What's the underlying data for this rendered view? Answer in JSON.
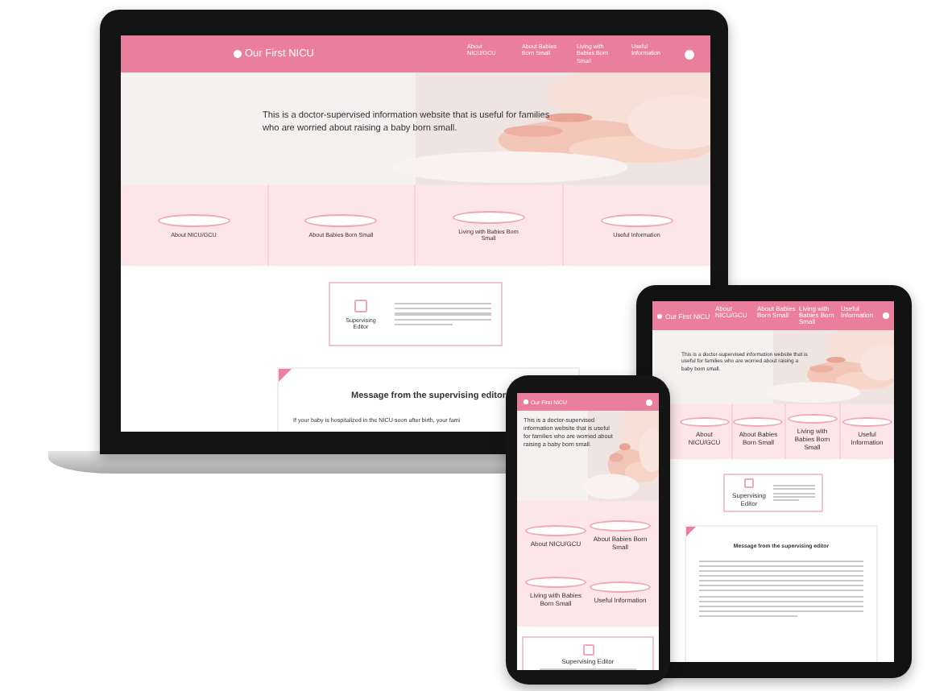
{
  "devices": [
    {
      "kind": "laptop",
      "site": {
        "logo": "Our First NICU",
        "nav": [
          "About NICU/GCU",
          "About Babies Born Small",
          "Living with Babies Born Small",
          "Useful Information"
        ],
        "hero": {
          "text": "This is a doctor-supervised information website that is useful for families who are worried about raising a baby born small."
        },
        "categories": [
          "About NICU/GCU",
          "About Babies Born Small",
          "Living with Babies Born Small",
          "Useful Information"
        ],
        "editor": {
          "label": "Supervising Editor"
        },
        "message": {
          "title": "Message from the supervising editor",
          "body": "If your baby is hospitalized in the NICU soon after birth, your fami"
        }
      }
    },
    {
      "kind": "tablet",
      "site": {
        "logo": "Our First NICU",
        "nav": [
          "About NICU/GCU",
          "About Babies Born Small",
          "Living with Babies Born Small",
          "Useful Information"
        ],
        "hero": {
          "text": "This is a doctor-supervised information website that is useful for families who are worried about raising a baby born small."
        },
        "categories": [
          "About NICU/GCU",
          "About Babies Born Small",
          "Living with Babies Born Small",
          "Useful Information"
        ],
        "editor": {
          "label": "Supervising Editor"
        },
        "message": {
          "title": "Message from the supervising editor"
        }
      }
    },
    {
      "kind": "phone",
      "site": {
        "logo": "Our First NICU",
        "hero": {
          "text": "This is a doctor-supervised information website that is useful for families who are worried about raising a baby born small."
        },
        "categories": [
          "About NICU/GCU",
          "About Babies Born Small",
          "Living with Babies Born Small",
          "Useful Information"
        ],
        "editor": {
          "label": "Supervising Editor"
        }
      }
    }
  ]
}
